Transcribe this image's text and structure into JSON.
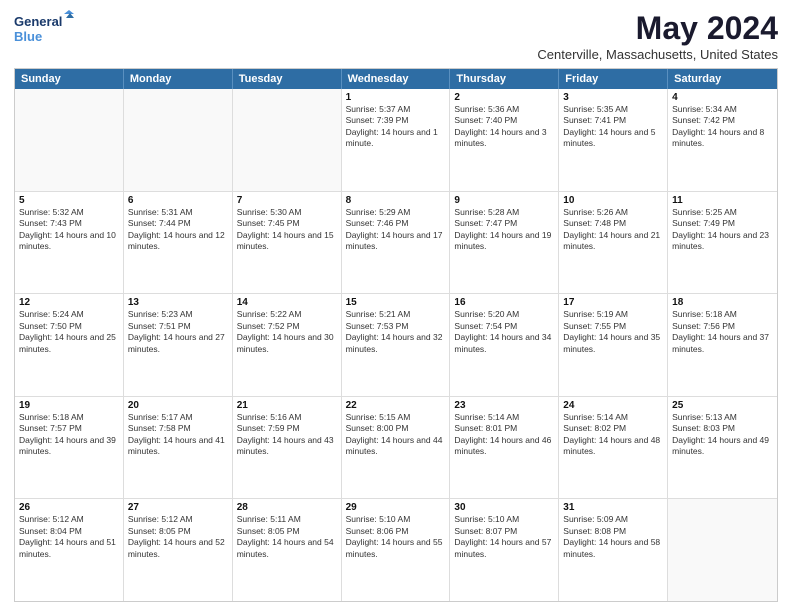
{
  "logo": {
    "line1": "General",
    "line2": "Blue"
  },
  "title": "May 2024",
  "subtitle": "Centerville, Massachusetts, United States",
  "header_days": [
    "Sunday",
    "Monday",
    "Tuesday",
    "Wednesday",
    "Thursday",
    "Friday",
    "Saturday"
  ],
  "weeks": [
    [
      {
        "day": "",
        "sunrise": "",
        "sunset": "",
        "daylight": ""
      },
      {
        "day": "",
        "sunrise": "",
        "sunset": "",
        "daylight": ""
      },
      {
        "day": "",
        "sunrise": "",
        "sunset": "",
        "daylight": ""
      },
      {
        "day": "1",
        "sunrise": "Sunrise: 5:37 AM",
        "sunset": "Sunset: 7:39 PM",
        "daylight": "Daylight: 14 hours and 1 minute."
      },
      {
        "day": "2",
        "sunrise": "Sunrise: 5:36 AM",
        "sunset": "Sunset: 7:40 PM",
        "daylight": "Daylight: 14 hours and 3 minutes."
      },
      {
        "day": "3",
        "sunrise": "Sunrise: 5:35 AM",
        "sunset": "Sunset: 7:41 PM",
        "daylight": "Daylight: 14 hours and 5 minutes."
      },
      {
        "day": "4",
        "sunrise": "Sunrise: 5:34 AM",
        "sunset": "Sunset: 7:42 PM",
        "daylight": "Daylight: 14 hours and 8 minutes."
      }
    ],
    [
      {
        "day": "5",
        "sunrise": "Sunrise: 5:32 AM",
        "sunset": "Sunset: 7:43 PM",
        "daylight": "Daylight: 14 hours and 10 minutes."
      },
      {
        "day": "6",
        "sunrise": "Sunrise: 5:31 AM",
        "sunset": "Sunset: 7:44 PM",
        "daylight": "Daylight: 14 hours and 12 minutes."
      },
      {
        "day": "7",
        "sunrise": "Sunrise: 5:30 AM",
        "sunset": "Sunset: 7:45 PM",
        "daylight": "Daylight: 14 hours and 15 minutes."
      },
      {
        "day": "8",
        "sunrise": "Sunrise: 5:29 AM",
        "sunset": "Sunset: 7:46 PM",
        "daylight": "Daylight: 14 hours and 17 minutes."
      },
      {
        "day": "9",
        "sunrise": "Sunrise: 5:28 AM",
        "sunset": "Sunset: 7:47 PM",
        "daylight": "Daylight: 14 hours and 19 minutes."
      },
      {
        "day": "10",
        "sunrise": "Sunrise: 5:26 AM",
        "sunset": "Sunset: 7:48 PM",
        "daylight": "Daylight: 14 hours and 21 minutes."
      },
      {
        "day": "11",
        "sunrise": "Sunrise: 5:25 AM",
        "sunset": "Sunset: 7:49 PM",
        "daylight": "Daylight: 14 hours and 23 minutes."
      }
    ],
    [
      {
        "day": "12",
        "sunrise": "Sunrise: 5:24 AM",
        "sunset": "Sunset: 7:50 PM",
        "daylight": "Daylight: 14 hours and 25 minutes."
      },
      {
        "day": "13",
        "sunrise": "Sunrise: 5:23 AM",
        "sunset": "Sunset: 7:51 PM",
        "daylight": "Daylight: 14 hours and 27 minutes."
      },
      {
        "day": "14",
        "sunrise": "Sunrise: 5:22 AM",
        "sunset": "Sunset: 7:52 PM",
        "daylight": "Daylight: 14 hours and 30 minutes."
      },
      {
        "day": "15",
        "sunrise": "Sunrise: 5:21 AM",
        "sunset": "Sunset: 7:53 PM",
        "daylight": "Daylight: 14 hours and 32 minutes."
      },
      {
        "day": "16",
        "sunrise": "Sunrise: 5:20 AM",
        "sunset": "Sunset: 7:54 PM",
        "daylight": "Daylight: 14 hours and 34 minutes."
      },
      {
        "day": "17",
        "sunrise": "Sunrise: 5:19 AM",
        "sunset": "Sunset: 7:55 PM",
        "daylight": "Daylight: 14 hours and 35 minutes."
      },
      {
        "day": "18",
        "sunrise": "Sunrise: 5:18 AM",
        "sunset": "Sunset: 7:56 PM",
        "daylight": "Daylight: 14 hours and 37 minutes."
      }
    ],
    [
      {
        "day": "19",
        "sunrise": "Sunrise: 5:18 AM",
        "sunset": "Sunset: 7:57 PM",
        "daylight": "Daylight: 14 hours and 39 minutes."
      },
      {
        "day": "20",
        "sunrise": "Sunrise: 5:17 AM",
        "sunset": "Sunset: 7:58 PM",
        "daylight": "Daylight: 14 hours and 41 minutes."
      },
      {
        "day": "21",
        "sunrise": "Sunrise: 5:16 AM",
        "sunset": "Sunset: 7:59 PM",
        "daylight": "Daylight: 14 hours and 43 minutes."
      },
      {
        "day": "22",
        "sunrise": "Sunrise: 5:15 AM",
        "sunset": "Sunset: 8:00 PM",
        "daylight": "Daylight: 14 hours and 44 minutes."
      },
      {
        "day": "23",
        "sunrise": "Sunrise: 5:14 AM",
        "sunset": "Sunset: 8:01 PM",
        "daylight": "Daylight: 14 hours and 46 minutes."
      },
      {
        "day": "24",
        "sunrise": "Sunrise: 5:14 AM",
        "sunset": "Sunset: 8:02 PM",
        "daylight": "Daylight: 14 hours and 48 minutes."
      },
      {
        "day": "25",
        "sunrise": "Sunrise: 5:13 AM",
        "sunset": "Sunset: 8:03 PM",
        "daylight": "Daylight: 14 hours and 49 minutes."
      }
    ],
    [
      {
        "day": "26",
        "sunrise": "Sunrise: 5:12 AM",
        "sunset": "Sunset: 8:04 PM",
        "daylight": "Daylight: 14 hours and 51 minutes."
      },
      {
        "day": "27",
        "sunrise": "Sunrise: 5:12 AM",
        "sunset": "Sunset: 8:05 PM",
        "daylight": "Daylight: 14 hours and 52 minutes."
      },
      {
        "day": "28",
        "sunrise": "Sunrise: 5:11 AM",
        "sunset": "Sunset: 8:05 PM",
        "daylight": "Daylight: 14 hours and 54 minutes."
      },
      {
        "day": "29",
        "sunrise": "Sunrise: 5:10 AM",
        "sunset": "Sunset: 8:06 PM",
        "daylight": "Daylight: 14 hours and 55 minutes."
      },
      {
        "day": "30",
        "sunrise": "Sunrise: 5:10 AM",
        "sunset": "Sunset: 8:07 PM",
        "daylight": "Daylight: 14 hours and 57 minutes."
      },
      {
        "day": "31",
        "sunrise": "Sunrise: 5:09 AM",
        "sunset": "Sunset: 8:08 PM",
        "daylight": "Daylight: 14 hours and 58 minutes."
      },
      {
        "day": "",
        "sunrise": "",
        "sunset": "",
        "daylight": ""
      }
    ]
  ]
}
